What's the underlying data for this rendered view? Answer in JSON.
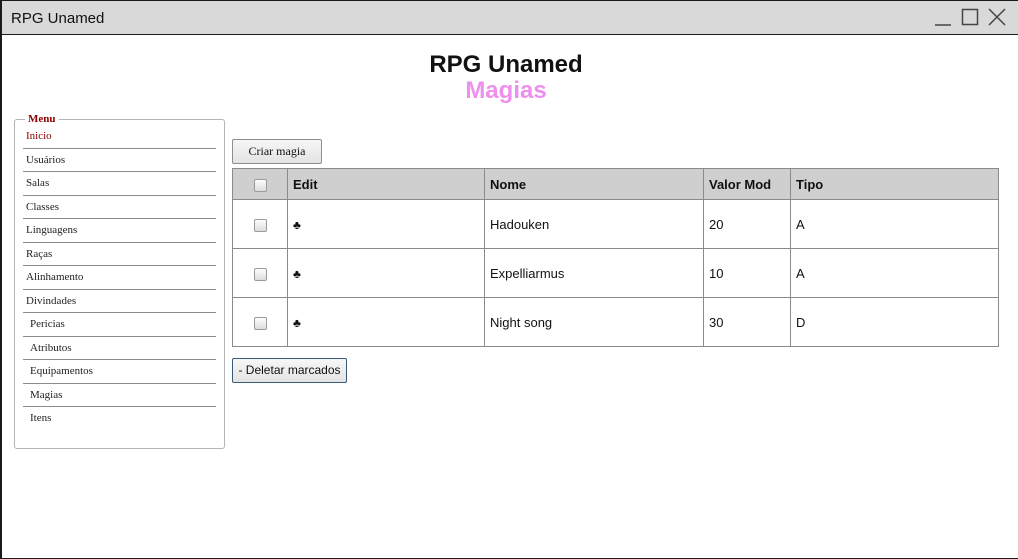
{
  "window": {
    "title": "RPG Unamed"
  },
  "header": {
    "app_title": "RPG Unamed",
    "page_title": "Magias"
  },
  "menu": {
    "legend": "Menu",
    "items": [
      {
        "label": "Inicio",
        "active": true
      },
      {
        "label": "Usuários"
      },
      {
        "label": "Salas"
      },
      {
        "label": "Classes"
      },
      {
        "label": "Linguagens"
      },
      {
        "label": "Raças"
      },
      {
        "label": "Alinhamento"
      },
      {
        "label": "Divindades"
      },
      {
        "label": "Pericias"
      },
      {
        "label": "Atributos"
      },
      {
        "label": "Equipamentos"
      },
      {
        "label": "Magias"
      },
      {
        "label": "Itens"
      }
    ]
  },
  "toolbar": {
    "create_label": "Criar magia",
    "delete_label": "- Deletar marcados"
  },
  "table": {
    "columns": [
      "",
      "Edit",
      "Nome",
      "Valor Mod",
      "Tipo"
    ],
    "edit_icon": "club-icon",
    "edit_glyph": "♣",
    "rows": [
      {
        "nome": "Hadouken",
        "valor_mod": "20",
        "tipo": "A"
      },
      {
        "nome": "Expelliarmus",
        "valor_mod": "10",
        "tipo": "A"
      },
      {
        "nome": "Night song",
        "valor_mod": "30",
        "tipo": "D"
      }
    ]
  },
  "colors": {
    "page_title": "#ee8fee",
    "menu_accent": "#8b0000",
    "table_header": "#cfcfcf"
  }
}
